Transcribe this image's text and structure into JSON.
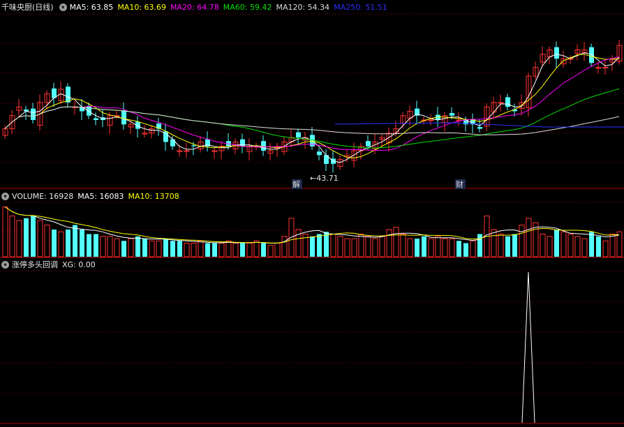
{
  "main": {
    "title": "千味央厨(日线)",
    "ma": [
      {
        "label": "MA5: 63.85",
        "color": "#ffffff"
      },
      {
        "label": "MA10: 63.69",
        "color": "#ffff00"
      },
      {
        "label": "MA20: 64.78",
        "color": "#ff00ff"
      },
      {
        "label": "MA60: 59.42",
        "color": "#00e000"
      },
      {
        "label": "MA120: 54.34",
        "color": "#dddddd"
      },
      {
        "label": "MA250: 51.51",
        "color": "#3030ff"
      }
    ],
    "low_label": "←43.71",
    "marker1": "解",
    "marker2": "财"
  },
  "volume": {
    "title": "VOLUME: 16928",
    "ma5": "MA5: 16083",
    "ma10": "MA10: 13708"
  },
  "indicator": {
    "title": "涨停多头回调",
    "xg": "XG: 0.00"
  },
  "colors": {
    "up": "#ff3232",
    "down": "#54ffff",
    "grid": "#8b0000",
    "panel_border": "#b00000"
  },
  "chart_data": {
    "type": "candlestick",
    "series_close": [
      52,
      55,
      57,
      56,
      54,
      58,
      60,
      59,
      61,
      58,
      57,
      56,
      55,
      54,
      54,
      55,
      55,
      53,
      53,
      52,
      51,
      52,
      52,
      49,
      48,
      47,
      47,
      48,
      49,
      48,
      47,
      48,
      48,
      49,
      48,
      48,
      48,
      47,
      47,
      48,
      49,
      50,
      50,
      50,
      48,
      46,
      44,
      44,
      45,
      46,
      47,
      48,
      48,
      49,
      50,
      51,
      52,
      55,
      56,
      55,
      54,
      54,
      54,
      55,
      55,
      54,
      53,
      53,
      52,
      57,
      58,
      58,
      57,
      56,
      58,
      64,
      66,
      69,
      70,
      68,
      68,
      68,
      70,
      70,
      67,
      66,
      66,
      68,
      71
    ],
    "volume_values": [
      22000,
      18000,
      16000,
      17000,
      18000,
      16000,
      14000,
      12000,
      11000,
      12000,
      14000,
      12000,
      10000,
      10000,
      9000,
      9000,
      8000,
      7000,
      8000,
      9000,
      8000,
      7000,
      7000,
      8000,
      7000,
      7000,
      6000,
      6000,
      7000,
      6000,
      6000,
      6000,
      7000,
      6000,
      6000,
      6000,
      7000,
      6000,
      5000,
      6000,
      9000,
      17000,
      12000,
      10000,
      9000,
      10000,
      11000,
      10000,
      9000,
      8000,
      8000,
      10000,
      9000,
      8000,
      9000,
      12000,
      13000,
      10000,
      8000,
      8000,
      9000,
      8000,
      9000,
      8000,
      8000,
      7000,
      6000,
      7000,
      10000,
      18000,
      12000,
      10000,
      9000,
      10000,
      14000,
      17000,
      15000,
      10000,
      9000,
      12000,
      11000,
      10000,
      9000,
      8000,
      11000,
      9000,
      7000,
      10000,
      11000
    ],
    "xg_signal_index": 75,
    "xg_value": 1,
    "low_price": 43.71
  }
}
